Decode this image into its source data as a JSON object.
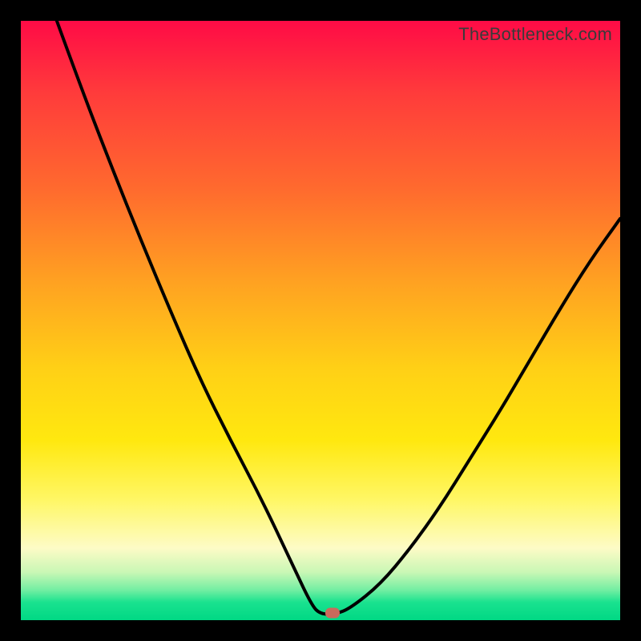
{
  "watermark": "TheBottleneck.com",
  "colors": {
    "frame": "#000000",
    "curve": "#000000",
    "marker": "#c96a5c"
  },
  "chart_data": {
    "type": "line",
    "title": "",
    "xlabel": "",
    "ylabel": "",
    "xlim": [
      0,
      100
    ],
    "ylim": [
      0,
      100
    ],
    "grid": false,
    "series": [
      {
        "name": "bottleneck-curve",
        "x": [
          6,
          10,
          15,
          20,
          25,
          30,
          35,
          40,
          45,
          48.5,
          50,
          52.5,
          55,
          60,
          65,
          70,
          75,
          80,
          85,
          90,
          95,
          100
        ],
        "y": [
          100,
          89,
          76,
          63.5,
          51.5,
          40,
          30,
          20.5,
          10,
          2.5,
          1,
          1,
          2,
          6,
          12,
          19,
          27,
          35,
          43.5,
          52,
          60,
          67
        ]
      }
    ],
    "marker": {
      "x": 52,
      "y": 1.2
    },
    "gradient_stops": [
      {
        "pos": 0,
        "color": "#ff0b46"
      },
      {
        "pos": 12,
        "color": "#ff3b3b"
      },
      {
        "pos": 28,
        "color": "#ff6a2e"
      },
      {
        "pos": 44,
        "color": "#ffa321"
      },
      {
        "pos": 58,
        "color": "#ffd016"
      },
      {
        "pos": 70,
        "color": "#ffe80f"
      },
      {
        "pos": 80,
        "color": "#fff766"
      },
      {
        "pos": 88,
        "color": "#fdfbc6"
      },
      {
        "pos": 92,
        "color": "#c9f7b5"
      },
      {
        "pos": 95,
        "color": "#72eea2"
      },
      {
        "pos": 97,
        "color": "#1ae28f"
      },
      {
        "pos": 100,
        "color": "#00d884"
      }
    ]
  }
}
